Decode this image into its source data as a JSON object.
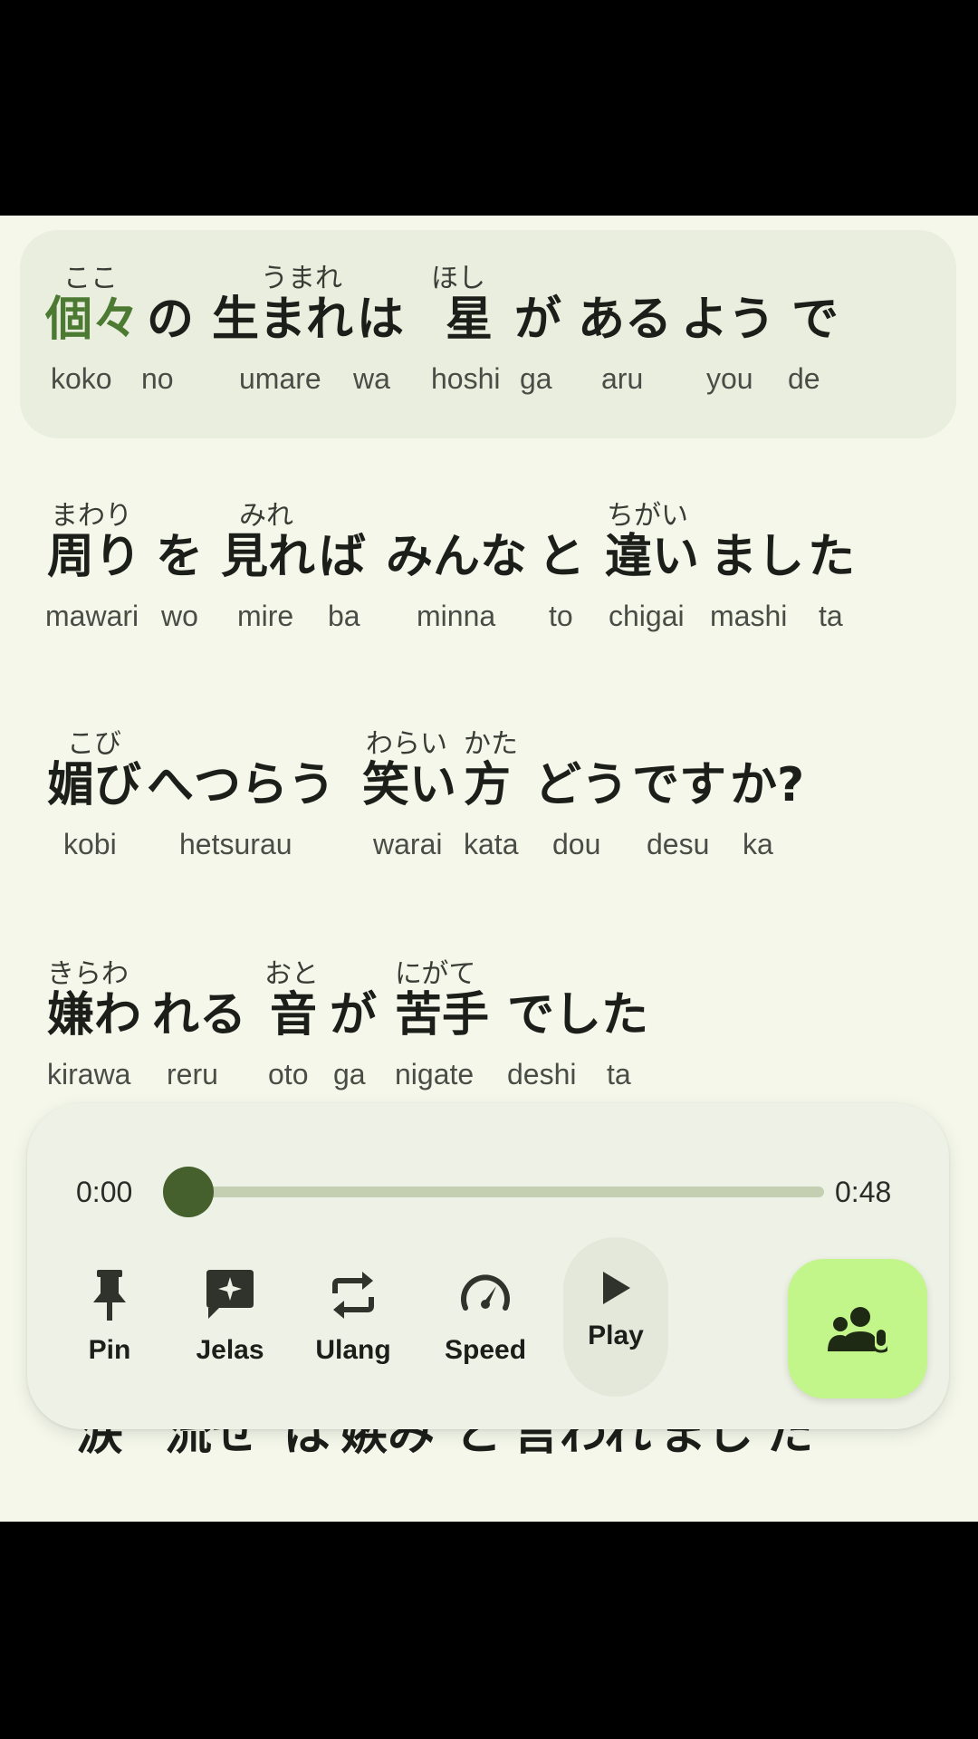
{
  "lyrics": [
    {
      "active": true,
      "words": [
        {
          "furigana": "ここ",
          "jp": "個々",
          "highlight": true,
          "romaji": "koko"
        },
        {
          "furigana": "",
          "jp": "の",
          "romaji": "no"
        },
        {
          "furigana": "うまれ",
          "jp": "生まれ",
          "romaji": "umare"
        },
        {
          "furigana": "",
          "jp": "は",
          "romaji": "wa"
        },
        {
          "furigana": "ほし",
          "jp": "星",
          "romaji": "hoshi"
        },
        {
          "furigana": "",
          "jp": "が",
          "romaji": "ga"
        },
        {
          "furigana": "",
          "jp": "ある",
          "romaji": "aru"
        },
        {
          "furigana": "",
          "jp": "よう",
          "romaji": "you"
        },
        {
          "furigana": "",
          "jp": "で",
          "romaji": "de"
        }
      ]
    },
    {
      "words": [
        {
          "furigana": "まわり",
          "jp": "周り",
          "romaji": "mawari"
        },
        {
          "furigana": "",
          "jp": "を",
          "romaji": "wo"
        },
        {
          "furigana": "みれ",
          "jp": "見れ",
          "romaji": "mire"
        },
        {
          "furigana": "",
          "jp": "ば",
          "romaji": "ba"
        },
        {
          "furigana": "",
          "jp": "みんな",
          "romaji": "minna"
        },
        {
          "furigana": "",
          "jp": "と",
          "romaji": "to"
        },
        {
          "furigana": "ちがい",
          "jp": "違い",
          "romaji": "chigai"
        },
        {
          "furigana": "",
          "jp": "まし",
          "romaji": "mashi"
        },
        {
          "furigana": "",
          "jp": "た",
          "romaji": "ta"
        }
      ]
    },
    {
      "words": [
        {
          "furigana": "こび",
          "jp": "媚び",
          "romaji": "kobi"
        },
        {
          "furigana": "",
          "jp": "へつらう",
          "romaji": "hetsurau"
        },
        {
          "furigana": "わらい",
          "jp": "笑い",
          "romaji": "warai"
        },
        {
          "furigana": "かた",
          "jp": "方",
          "romaji": "kata"
        },
        {
          "furigana": "",
          "jp": "どう",
          "romaji": "dou"
        },
        {
          "furigana": "",
          "jp": "です",
          "romaji": "desu"
        },
        {
          "furigana": "",
          "jp": "か?",
          "romaji": "ka"
        }
      ]
    },
    {
      "words": [
        {
          "furigana": "きらわ",
          "jp": "嫌わ",
          "romaji": "kirawa"
        },
        {
          "furigana": "",
          "jp": "れる",
          "romaji": "reru"
        },
        {
          "furigana": "おと",
          "jp": "音",
          "romaji": "oto"
        },
        {
          "furigana": "",
          "jp": "が",
          "romaji": "ga"
        },
        {
          "furigana": "にがて",
          "jp": "苦手",
          "romaji": "nigate"
        },
        {
          "furigana": "",
          "jp": "でし",
          "romaji": "deshi"
        },
        {
          "furigana": "",
          "jp": "た",
          "romaji": "ta"
        }
      ]
    },
    {
      "words": [
        {
          "furigana": "",
          "jp": "涙",
          "romaji": ""
        },
        {
          "furigana": "",
          "jp": "流せ",
          "romaji": ""
        },
        {
          "furigana": "",
          "jp": "ば",
          "romaji": ""
        },
        {
          "furigana": "",
          "jp": "嫉み",
          "romaji": ""
        },
        {
          "furigana": "",
          "jp": "と",
          "romaji": ""
        },
        {
          "furigana": "",
          "jp": "言われ",
          "romaji": ""
        },
        {
          "furigana": "",
          "jp": "まし",
          "romaji": ""
        },
        {
          "furigana": "",
          "jp": "た",
          "romaji": ""
        }
      ]
    }
  ],
  "player": {
    "current_time": "0:00",
    "total_time": "0:48",
    "progress": 0.0,
    "controls": [
      {
        "id": "pin",
        "label": "Pin",
        "icon": "pin-icon"
      },
      {
        "id": "jelas",
        "label": "Jelas",
        "icon": "explain-sparkle-icon"
      },
      {
        "id": "ulang",
        "label": "Ulang",
        "icon": "repeat-icon"
      },
      {
        "id": "speed",
        "label": "Speed",
        "icon": "speedometer-icon"
      },
      {
        "id": "play",
        "label": "Play",
        "icon": "play-icon"
      }
    ],
    "voice_button_icon": "voice-group-icon",
    "accent_color": "#c2f58a",
    "highlight_color": "#4d7a32"
  }
}
